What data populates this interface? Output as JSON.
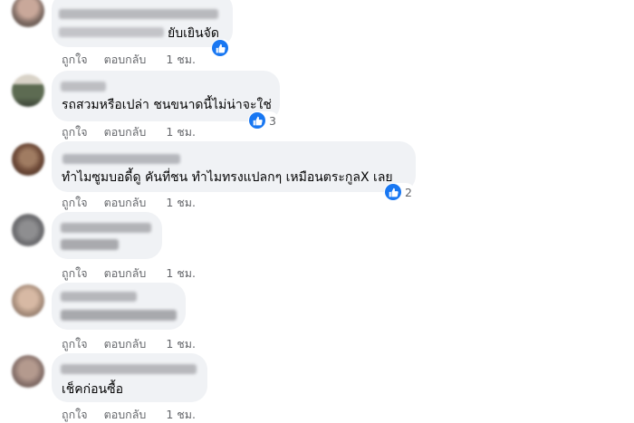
{
  "comments": [
    {
      "text": "ยับเยินจัด",
      "actions": {
        "like": "ถูกใจ",
        "reply": "ตอบกลับ",
        "time": "1 ชม."
      },
      "reaction_count": ""
    },
    {
      "text": "รถสวมหรือเปล่า ชนขนาดนี้ไม่น่าจะใช่",
      "actions": {
        "like": "ถูกใจ",
        "reply": "ตอบกลับ",
        "time": "1 ชม."
      },
      "reaction_count": "3"
    },
    {
      "text": "ทำไมซูมบอดี้ดู คันที่ชน ทำไมทรงแปลกๆ เหมือนตระกูลX เลย",
      "actions": {
        "like": "ถูกใจ",
        "reply": "ตอบกลับ",
        "time": "1 ชม."
      },
      "reaction_count": "2"
    },
    {
      "text": "",
      "actions": {
        "like": "ถูกใจ",
        "reply": "ตอบกลับ",
        "time": "1 ชม."
      },
      "reaction_count": ""
    },
    {
      "text": "",
      "actions": {
        "like": "ถูกใจ",
        "reply": "ตอบกลับ",
        "time": "1 ชม."
      },
      "reaction_count": ""
    },
    {
      "text": "เช็คก่อนซื้อ",
      "actions": {
        "like": "ถูกใจ",
        "reply": "ตอบกลับ",
        "time": "1 ชม."
      },
      "reaction_count": ""
    }
  ],
  "icons": {
    "reaction": "like-thumb-icon"
  },
  "colors": {
    "accent": "#1877f2",
    "bubble": "#f0f2f5",
    "muted": "#65676b"
  }
}
